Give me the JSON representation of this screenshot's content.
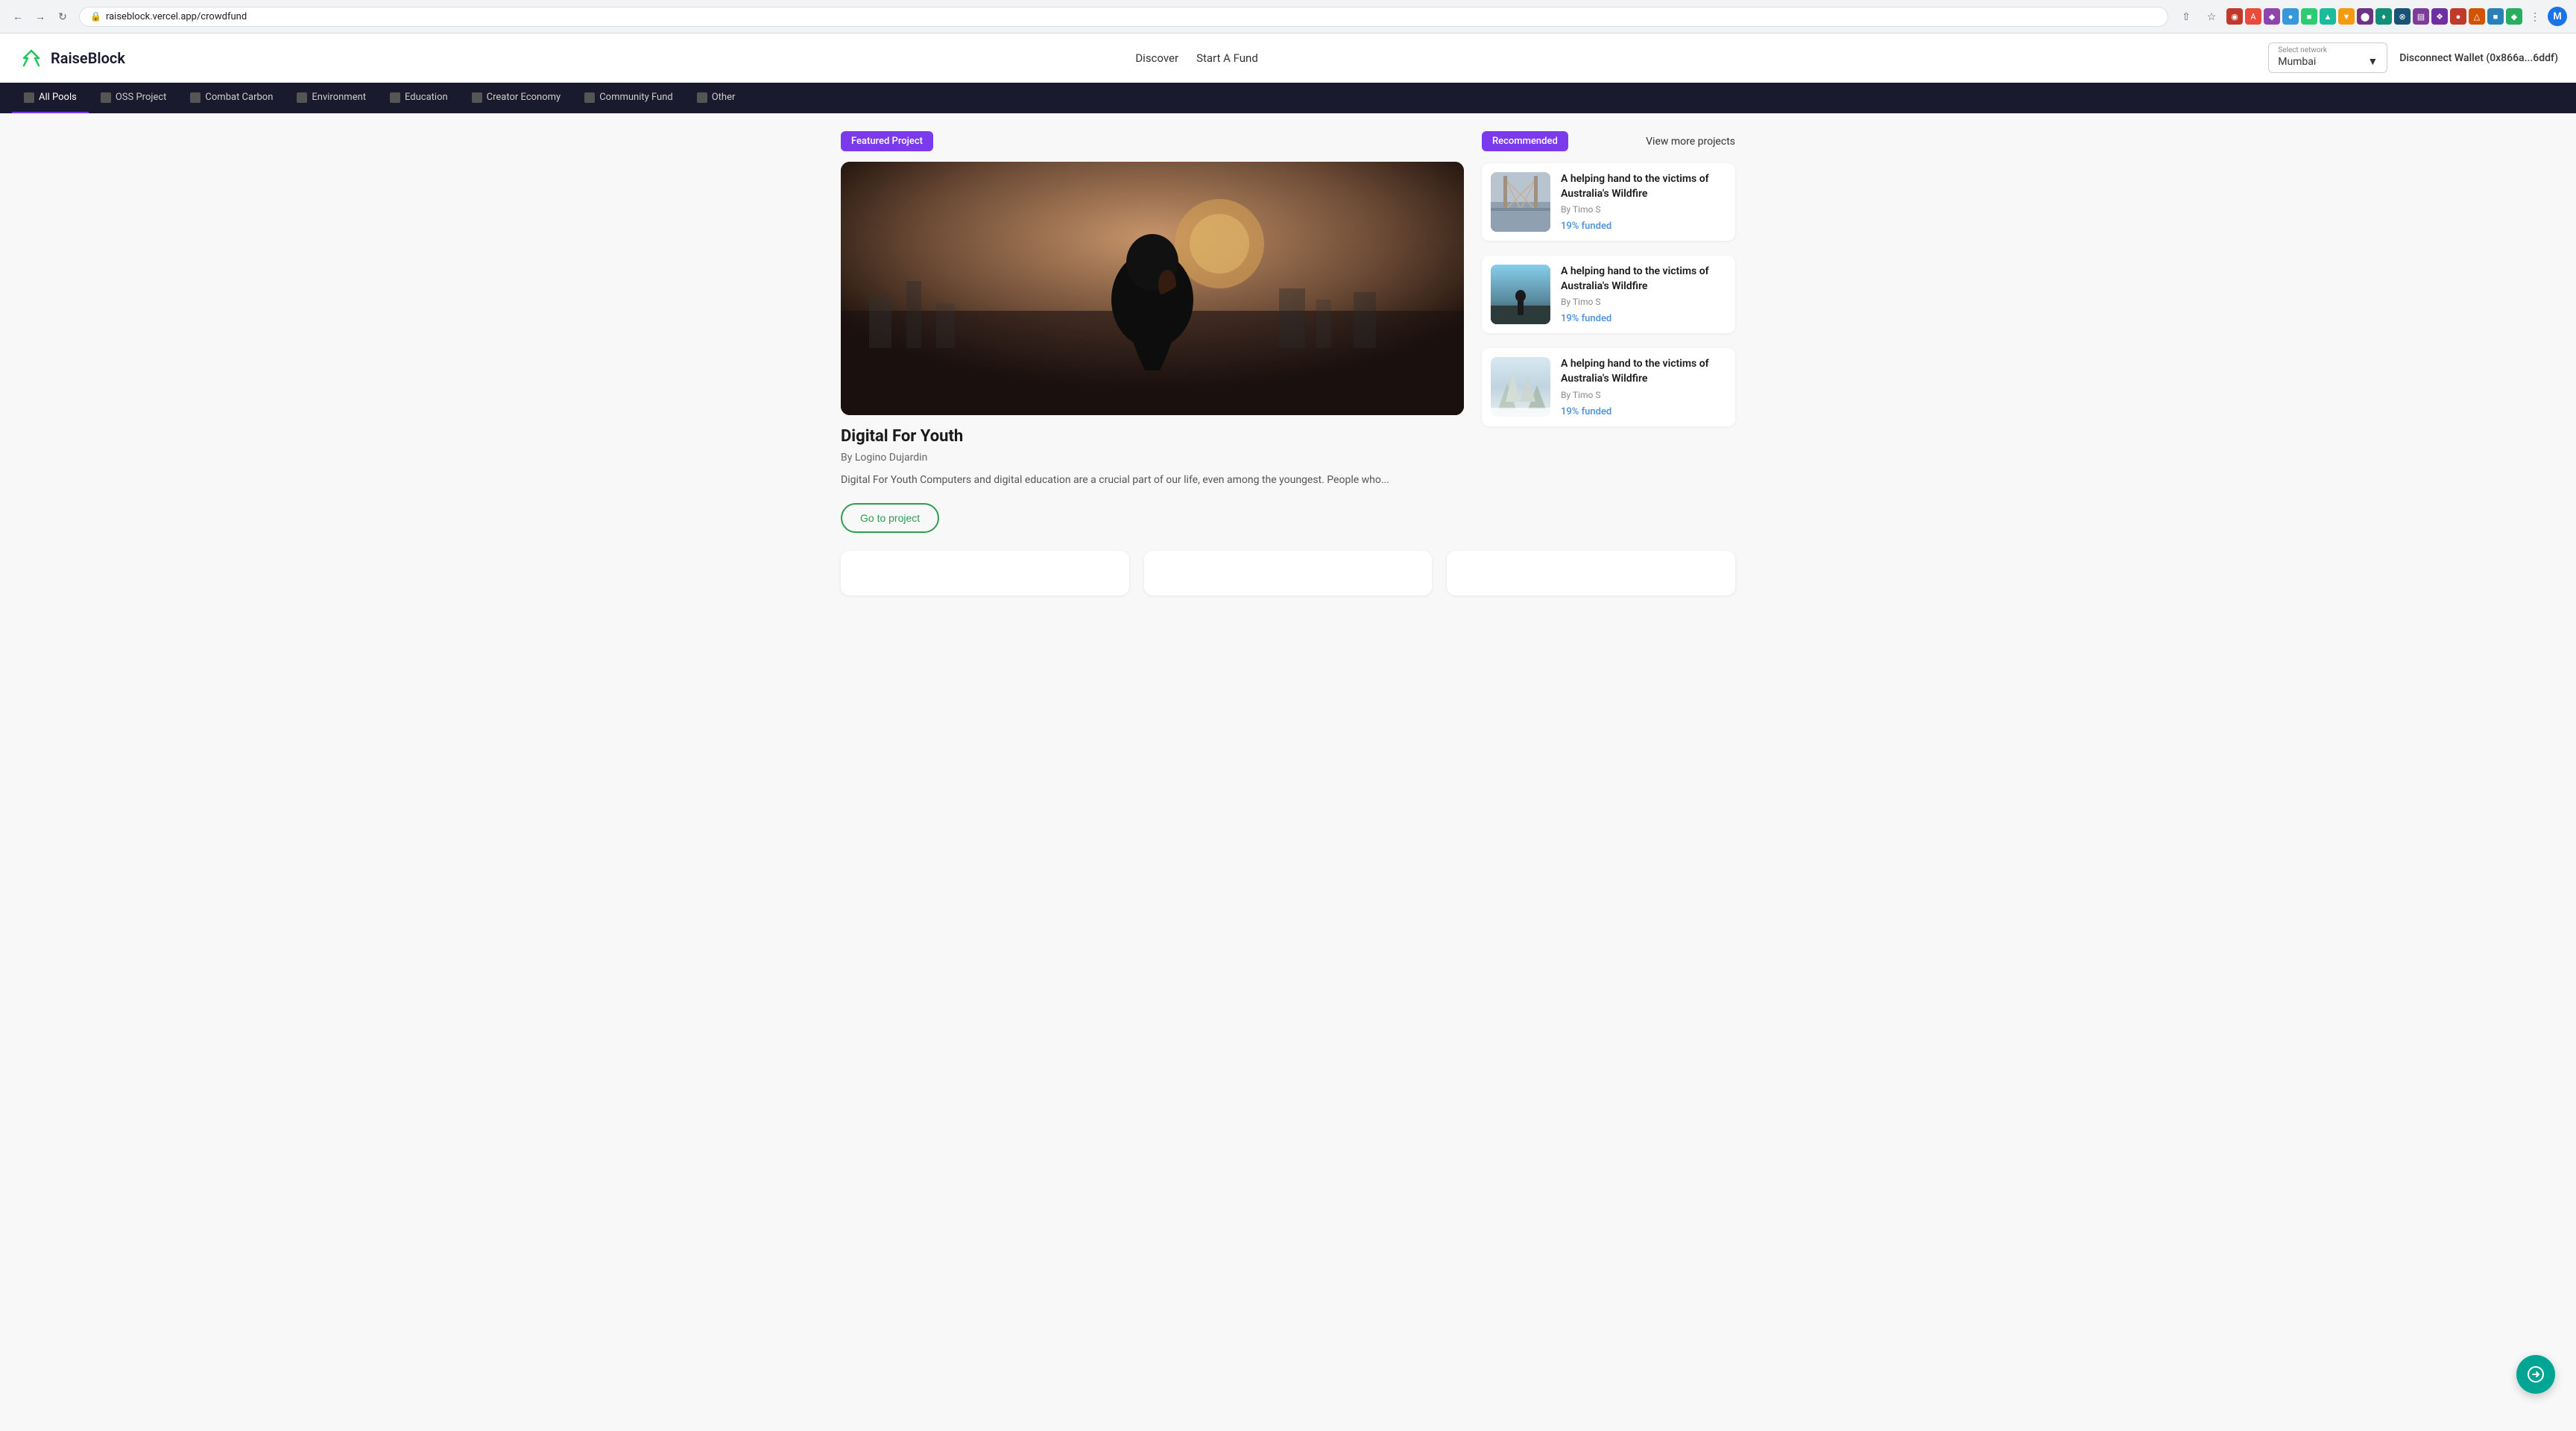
{
  "browser": {
    "url": "raiseblock.vercel.app/crowdfund",
    "profile_initial": "M"
  },
  "header": {
    "logo_text": "RaiseBlock",
    "nav": {
      "discover_label": "Discover",
      "start_fund_label": "Start A Fund"
    },
    "network_select": {
      "label": "Select network",
      "value": "Mumbai"
    },
    "disconnect_label": "Disconnect Wallet (0x866a...6ddf)"
  },
  "category_nav": {
    "items": [
      {
        "id": "all-pools",
        "label": "All Pools"
      },
      {
        "id": "oss-project",
        "label": "OSS Project"
      },
      {
        "id": "combat-carbon",
        "label": "Combat Carbon"
      },
      {
        "id": "environment",
        "label": "Environment"
      },
      {
        "id": "education",
        "label": "Education"
      },
      {
        "id": "creator-economy",
        "label": "Creator Economy"
      },
      {
        "id": "community-fund",
        "label": "Community Fund"
      },
      {
        "id": "other",
        "label": "Other"
      }
    ]
  },
  "featured": {
    "badge_label": "Featured Project",
    "title": "Digital For Youth",
    "author": "By Logino Dujardin",
    "description": "Digital For Youth Computers and digital education are a crucial part of our life, even among the youngest. People who...",
    "cta_label": "Go to project"
  },
  "recommended": {
    "badge_label": "Recommended",
    "view_more_label": "View more projects",
    "items": [
      {
        "title": "A helping hand to the victims of Australia's Wildfire",
        "author": "By Timo S",
        "funded": "19% funded"
      },
      {
        "title": "A helping hand to the victims of Australia's Wildfire",
        "author": "By Timo S",
        "funded": "19% funded"
      },
      {
        "title": "A helping hand to the victims of Australia's Wildfire",
        "author": "By Timo S",
        "funded": "19% funded"
      }
    ]
  },
  "fab": {
    "icon": "→"
  }
}
